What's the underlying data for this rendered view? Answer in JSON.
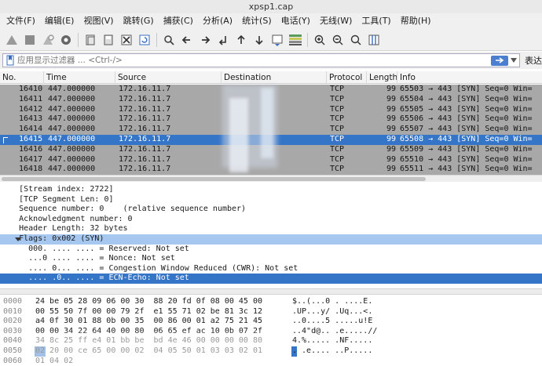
{
  "window": {
    "title": "xpsp1.cap"
  },
  "menu": [
    "文件(F)",
    "编辑(E)",
    "视图(V)",
    "跳转(G)",
    "捕获(C)",
    "分析(A)",
    "统计(S)",
    "电话(Y)",
    "无线(W)",
    "工具(T)",
    "帮助(H)"
  ],
  "filter": {
    "placeholder": "应用显示过滤器 ... <Ctrl-/>",
    "expression_label": "表达"
  },
  "packet_list": {
    "columns": [
      "No.",
      "Time",
      "Source",
      "Destination",
      "Protocol",
      "Length",
      "Info"
    ],
    "rows": [
      {
        "no": "16410",
        "time": "447.000000",
        "src": "172.16.11.7",
        "dst": "",
        "proto": "TCP",
        "len": "99",
        "info": "65503 → 443 [SYN] Seq=0 Win="
      },
      {
        "no": "16411",
        "time": "447.000000",
        "src": "172.16.11.7",
        "dst": "",
        "proto": "TCP",
        "len": "99",
        "info": "65504 → 443 [SYN] Seq=0 Win="
      },
      {
        "no": "16412",
        "time": "447.000000",
        "src": "172.16.11.7",
        "dst": "",
        "proto": "TCP",
        "len": "99",
        "info": "65505 → 443 [SYN] Seq=0 Win="
      },
      {
        "no": "16413",
        "time": "447.000000",
        "src": "172.16.11.7",
        "dst": "",
        "proto": "TCP",
        "len": "99",
        "info": "65506 → 443 [SYN] Seq=0 Win="
      },
      {
        "no": "16414",
        "time": "447.000000",
        "src": "172.16.11.7",
        "dst": "",
        "proto": "TCP",
        "len": "99",
        "info": "65507 → 443 [SYN] Seq=0 Win="
      },
      {
        "no": "16415",
        "time": "447.000000",
        "src": "172.16.11.7",
        "dst": "",
        "proto": "TCP",
        "len": "99",
        "info": "65508 → 443 [SYN] Seq=0 Win=",
        "selected": true
      },
      {
        "no": "16416",
        "time": "447.000000",
        "src": "172.16.11.7",
        "dst": "",
        "proto": "TCP",
        "len": "99",
        "info": "65509 → 443 [SYN] Seq=0 Win="
      },
      {
        "no": "16417",
        "time": "447.000000",
        "src": "172.16.11.7",
        "dst": "",
        "proto": "TCP",
        "len": "99",
        "info": "65510 → 443 [SYN] Seq=0 Win="
      },
      {
        "no": "16418",
        "time": "447.000000",
        "src": "172.16.11.7",
        "dst": "",
        "proto": "TCP",
        "len": "99",
        "info": "65511 → 443 [SYN] Seq=0 Win="
      }
    ]
  },
  "details": [
    {
      "text": "    [Stream index: 2722]"
    },
    {
      "text": "    [TCP Segment Len: 0]"
    },
    {
      "text": "    Sequence number: 0    (relative sequence number)"
    },
    {
      "text": "    Acknowledgment number: 0"
    },
    {
      "text": "    Header Length: 32 bytes"
    },
    {
      "text": "    Flags: 0x002 (SYN)",
      "state": "highlight",
      "expanded": true
    },
    {
      "text": "      000. .... .... = Reserved: Not set"
    },
    {
      "text": "      ...0 .... .... = Nonce: Not set"
    },
    {
      "text": "      .... 0... .... = Congestion Window Reduced (CWR): Not set"
    },
    {
      "text": "      .... .0.. .... = ECN-Echo: Not set",
      "state": "selected"
    }
  ],
  "bytes": [
    {
      "offset": "0000",
      "hex": "24 be 05 28 09 06 00 30  88 20 fd 0f 08 00 45 00",
      "ascii": "$..(...0 . ....E."
    },
    {
      "offset": "0010",
      "hex": "00 55 50 7f 00 00 79 2f  e1 55 71 02 be 81 3c 12",
      "ascii": ".UP...y/ .Uq...<."
    },
    {
      "offset": "0020",
      "hex": "a4 0f 30 01 88 0b 00 35  00 86 00 01 a2 75 21 45",
      "ascii": "..0....5 .....u!E"
    },
    {
      "offset": "0030",
      "hex": "00 00 34 22 64 40 00 80  06 65 ef ac 10 0b 07 2f",
      "ascii": "..4\"d@.. .e.....//"
    },
    {
      "offset": "0040",
      "hex": "34 8c 25 ff e4 01 bb be  bd 4e 46 00 00 00 00 80",
      "ascii": "4.%..... .NF....."
    },
    {
      "offset": "0050",
      "hex": "02 20 00 ce 65 00 00 02  04 05 50 01 03 03 02 01",
      "ascii": ". .e.... ..P....."
    },
    {
      "offset": "0060",
      "hex": "01 04 02",
      "ascii": ""
    }
  ],
  "colors": {
    "selection": "#3475c8",
    "row_bg": "#a8a8a8",
    "flags_highlight": "#a6c8f0"
  }
}
